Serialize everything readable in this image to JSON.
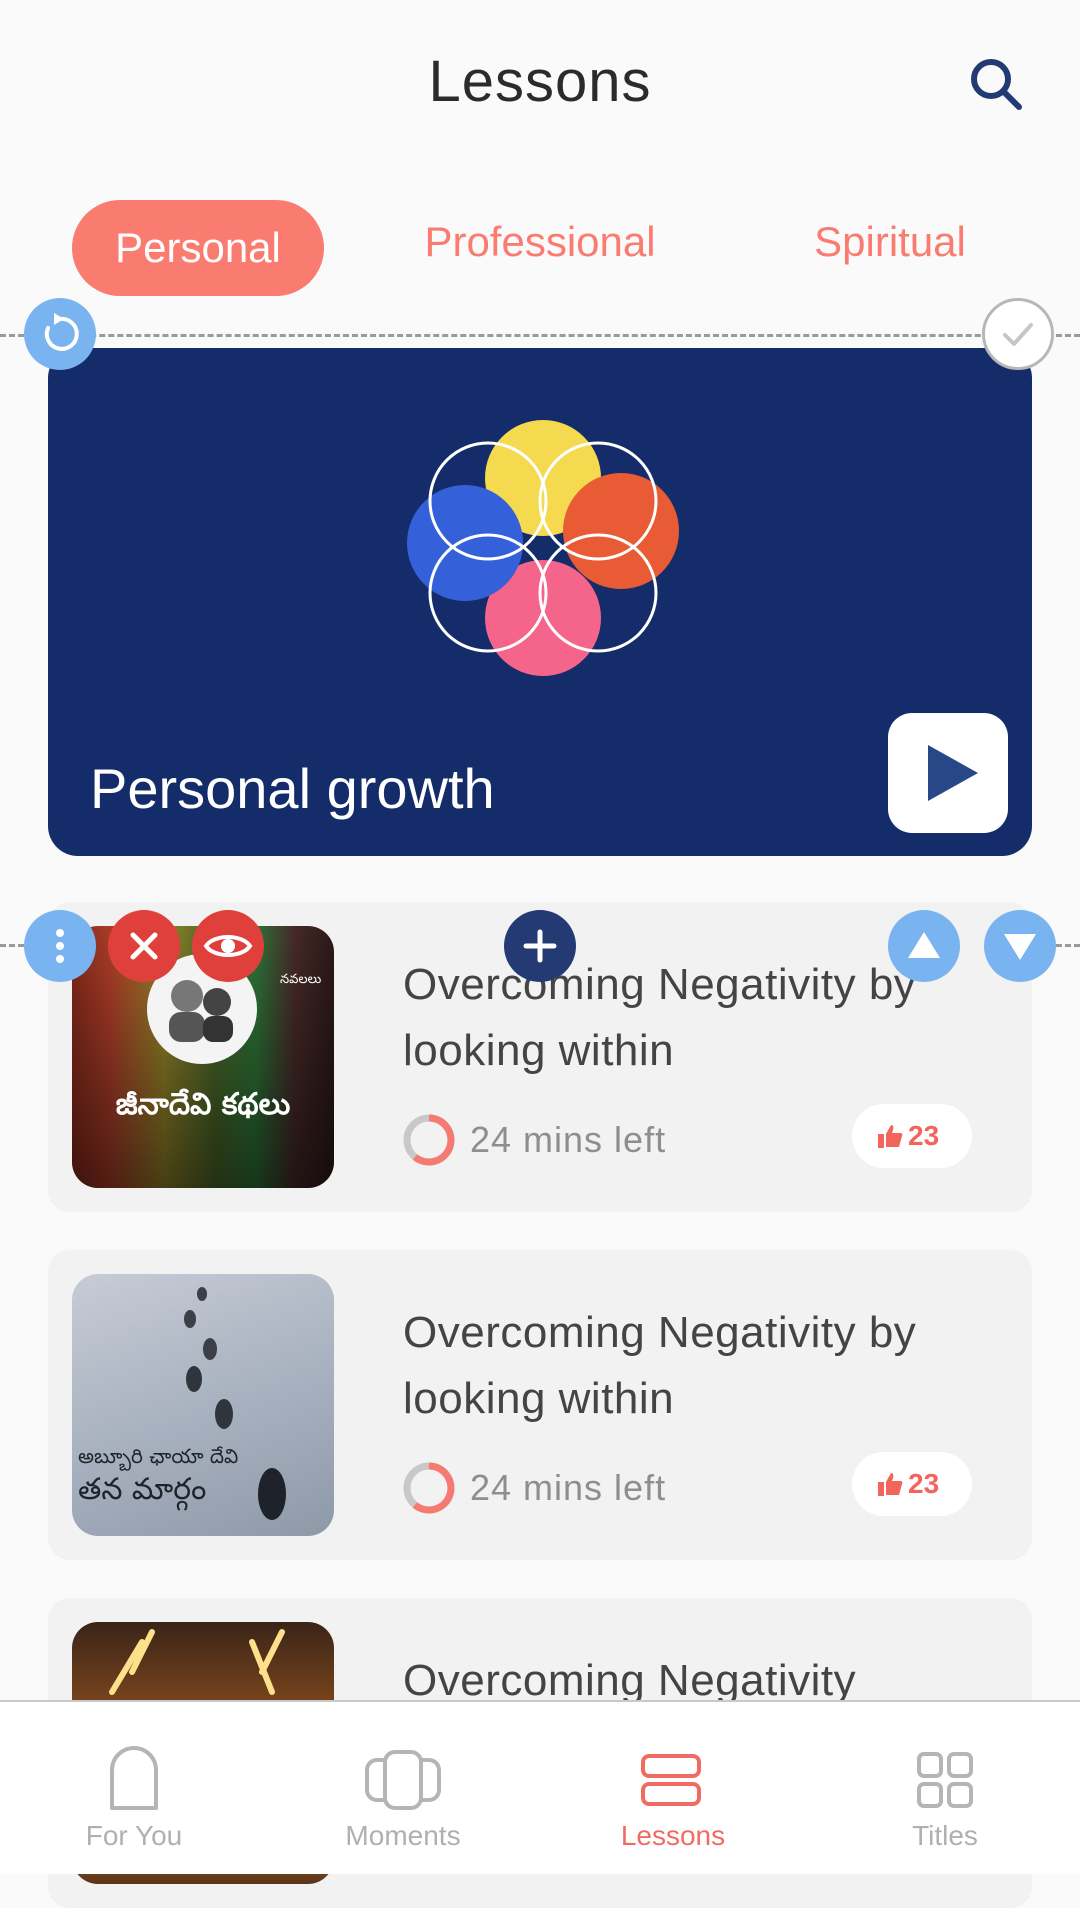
{
  "header": {
    "title": "Lessons"
  },
  "tabs": [
    {
      "label": "Personal",
      "active": true
    },
    {
      "label": "Professional",
      "active": false
    },
    {
      "label": "Spiritual",
      "active": false
    }
  ],
  "hero": {
    "title": "Personal growth"
  },
  "lessons": [
    {
      "title": "Overcoming Negativity by looking within",
      "time_left": "24 mins left",
      "likes": "23",
      "thumb_caption": "జీనాదేవి కథలు",
      "thumb_badge": "నవలలు"
    },
    {
      "title": "Overcoming Negativity by looking within",
      "time_left": "24 mins left",
      "likes": "23",
      "thumb_caption_top": "అబ్బూరి ఛాయా దేవి",
      "thumb_caption": "తన మార్గం"
    },
    {
      "title": "Overcoming Negativity"
    }
  ],
  "bottom_nav": [
    {
      "label": "For You",
      "icon": "for-you-icon",
      "active": false
    },
    {
      "label": "Moments",
      "icon": "moments-icon",
      "active": false
    },
    {
      "label": "Lessons",
      "icon": "lessons-icon",
      "active": true
    },
    {
      "label": "Titles",
      "icon": "titles-icon",
      "active": false
    }
  ],
  "colors": {
    "accent": "#fa7c70",
    "hero_bg": "#142c69",
    "control_blue": "#7ab4f0",
    "delete_red": "#e0403c"
  }
}
